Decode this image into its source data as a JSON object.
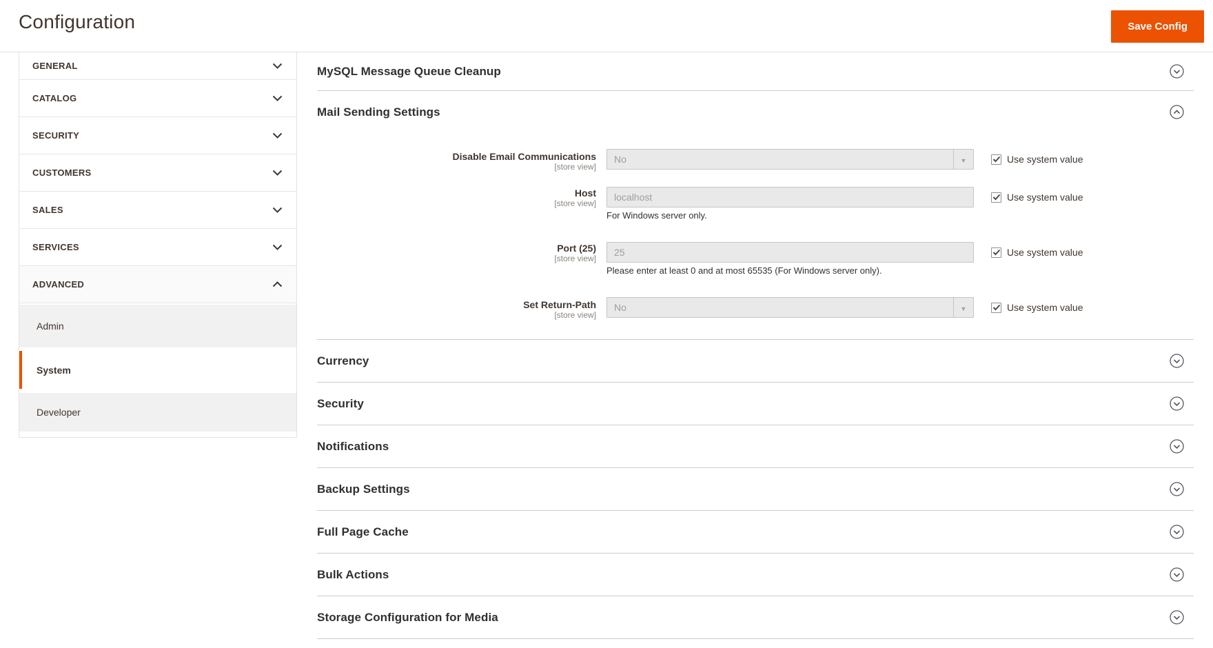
{
  "header": {
    "title": "Configuration",
    "save_button": "Save Config"
  },
  "colors": {
    "accent_orange": "#eb5202",
    "disabled_field_bg": "#e9e9e9",
    "divider": "#cccccc"
  },
  "sidebar": {
    "items": [
      {
        "label": "GENERAL",
        "state": "collapsed"
      },
      {
        "label": "CATALOG",
        "state": "collapsed"
      },
      {
        "label": "SECURITY",
        "state": "collapsed"
      },
      {
        "label": "CUSTOMERS",
        "state": "collapsed"
      },
      {
        "label": "SALES",
        "state": "collapsed"
      },
      {
        "label": "SERVICES",
        "state": "collapsed"
      },
      {
        "label": "ADVANCED",
        "state": "expanded"
      }
    ],
    "advanced_children": [
      {
        "label": "Admin",
        "active": false
      },
      {
        "label": "System",
        "active": true
      },
      {
        "label": "Developer",
        "active": false
      }
    ]
  },
  "main": {
    "top_section": {
      "title": "MySQL Message Queue Cleanup",
      "state": "collapsed"
    },
    "expanded_section": {
      "title": "Mail Sending Settings",
      "state": "expanded",
      "fields": [
        {
          "label": "Disable Email Communications",
          "scope": "[store view]",
          "value": "No",
          "control": "select",
          "disabled": true,
          "checkbox_label": "Use system value",
          "checked": true
        },
        {
          "label": "Host",
          "scope": "[store view]",
          "value": "localhost",
          "control": "text",
          "disabled": true,
          "note": "For Windows server only.",
          "checkbox_label": "Use system value",
          "checked": true
        },
        {
          "label": "Port (25)",
          "scope": "[store view]",
          "value": "25",
          "control": "text",
          "disabled": true,
          "note": "Please enter at least 0 and at most 65535 (For Windows server only).",
          "checkbox_label": "Use system value",
          "checked": true
        },
        {
          "label": "Set Return-Path",
          "scope": "[store view]",
          "value": "No",
          "control": "select",
          "disabled": true,
          "checkbox_label": "Use system value",
          "checked": true
        }
      ]
    },
    "collapsed_sections": [
      {
        "title": "Currency"
      },
      {
        "title": "Security"
      },
      {
        "title": "Notifications"
      },
      {
        "title": "Backup Settings"
      },
      {
        "title": "Full Page Cache"
      },
      {
        "title": "Bulk Actions"
      },
      {
        "title": "Storage Configuration for Media"
      }
    ]
  }
}
